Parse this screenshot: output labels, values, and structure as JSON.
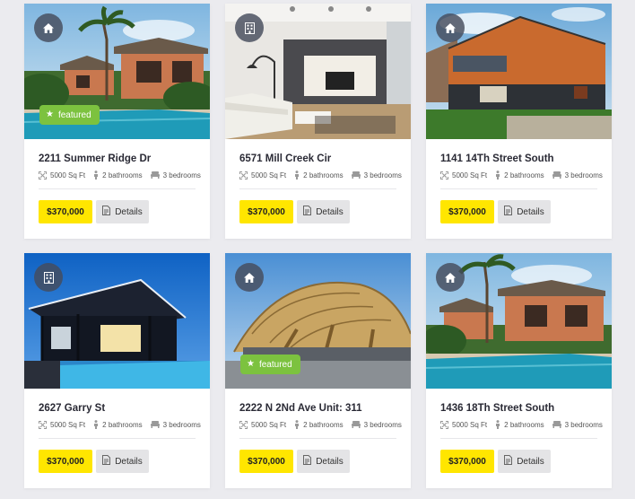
{
  "listings": [
    {
      "address": "2211 Summer Ridge Dr",
      "area": "5000 Sq Ft",
      "bathrooms": "2 bathrooms",
      "bedrooms": "3 bedrooms",
      "price": "$370,000",
      "details_label": "Details",
      "type_icon": "house-icon",
      "featured_label": "featured"
    },
    {
      "address": "6571 Mill Creek Cir",
      "area": "5000 Sq Ft",
      "bathrooms": "2 bathrooms",
      "bedrooms": "3 bedrooms",
      "price": "$370,000",
      "details_label": "Details",
      "type_icon": "building-icon"
    },
    {
      "address": "1141 14Th Street South",
      "area": "5000 Sq Ft",
      "bathrooms": "2 bathrooms",
      "bedrooms": "3 bedrooms",
      "price": "$370,000",
      "details_label": "Details",
      "type_icon": "house-icon"
    },
    {
      "address": "2627 Garry St",
      "area": "5000 Sq Ft",
      "bathrooms": "2 bathrooms",
      "bedrooms": "3 bedrooms",
      "price": "$370,000",
      "details_label": "Details",
      "type_icon": "building-icon"
    },
    {
      "address": "2222 N 2Nd Ave Unit: 311",
      "area": "5000 Sq Ft",
      "bathrooms": "2 bathrooms",
      "bedrooms": "3 bedrooms",
      "price": "$370,000",
      "details_label": "Details",
      "type_icon": "house-icon",
      "featured_label": "featured"
    },
    {
      "address": "1436 18Th Street South",
      "area": "5000 Sq Ft",
      "bathrooms": "2 bathrooms",
      "bedrooms": "3 bedrooms",
      "price": "$370,000",
      "details_label": "Details",
      "type_icon": "house-icon"
    }
  ],
  "colors": {
    "price_bg": "#ffe600",
    "featured_bg": "#7cc23f",
    "details_bg": "#e4e4e6",
    "page_bg": "#ebebef"
  }
}
